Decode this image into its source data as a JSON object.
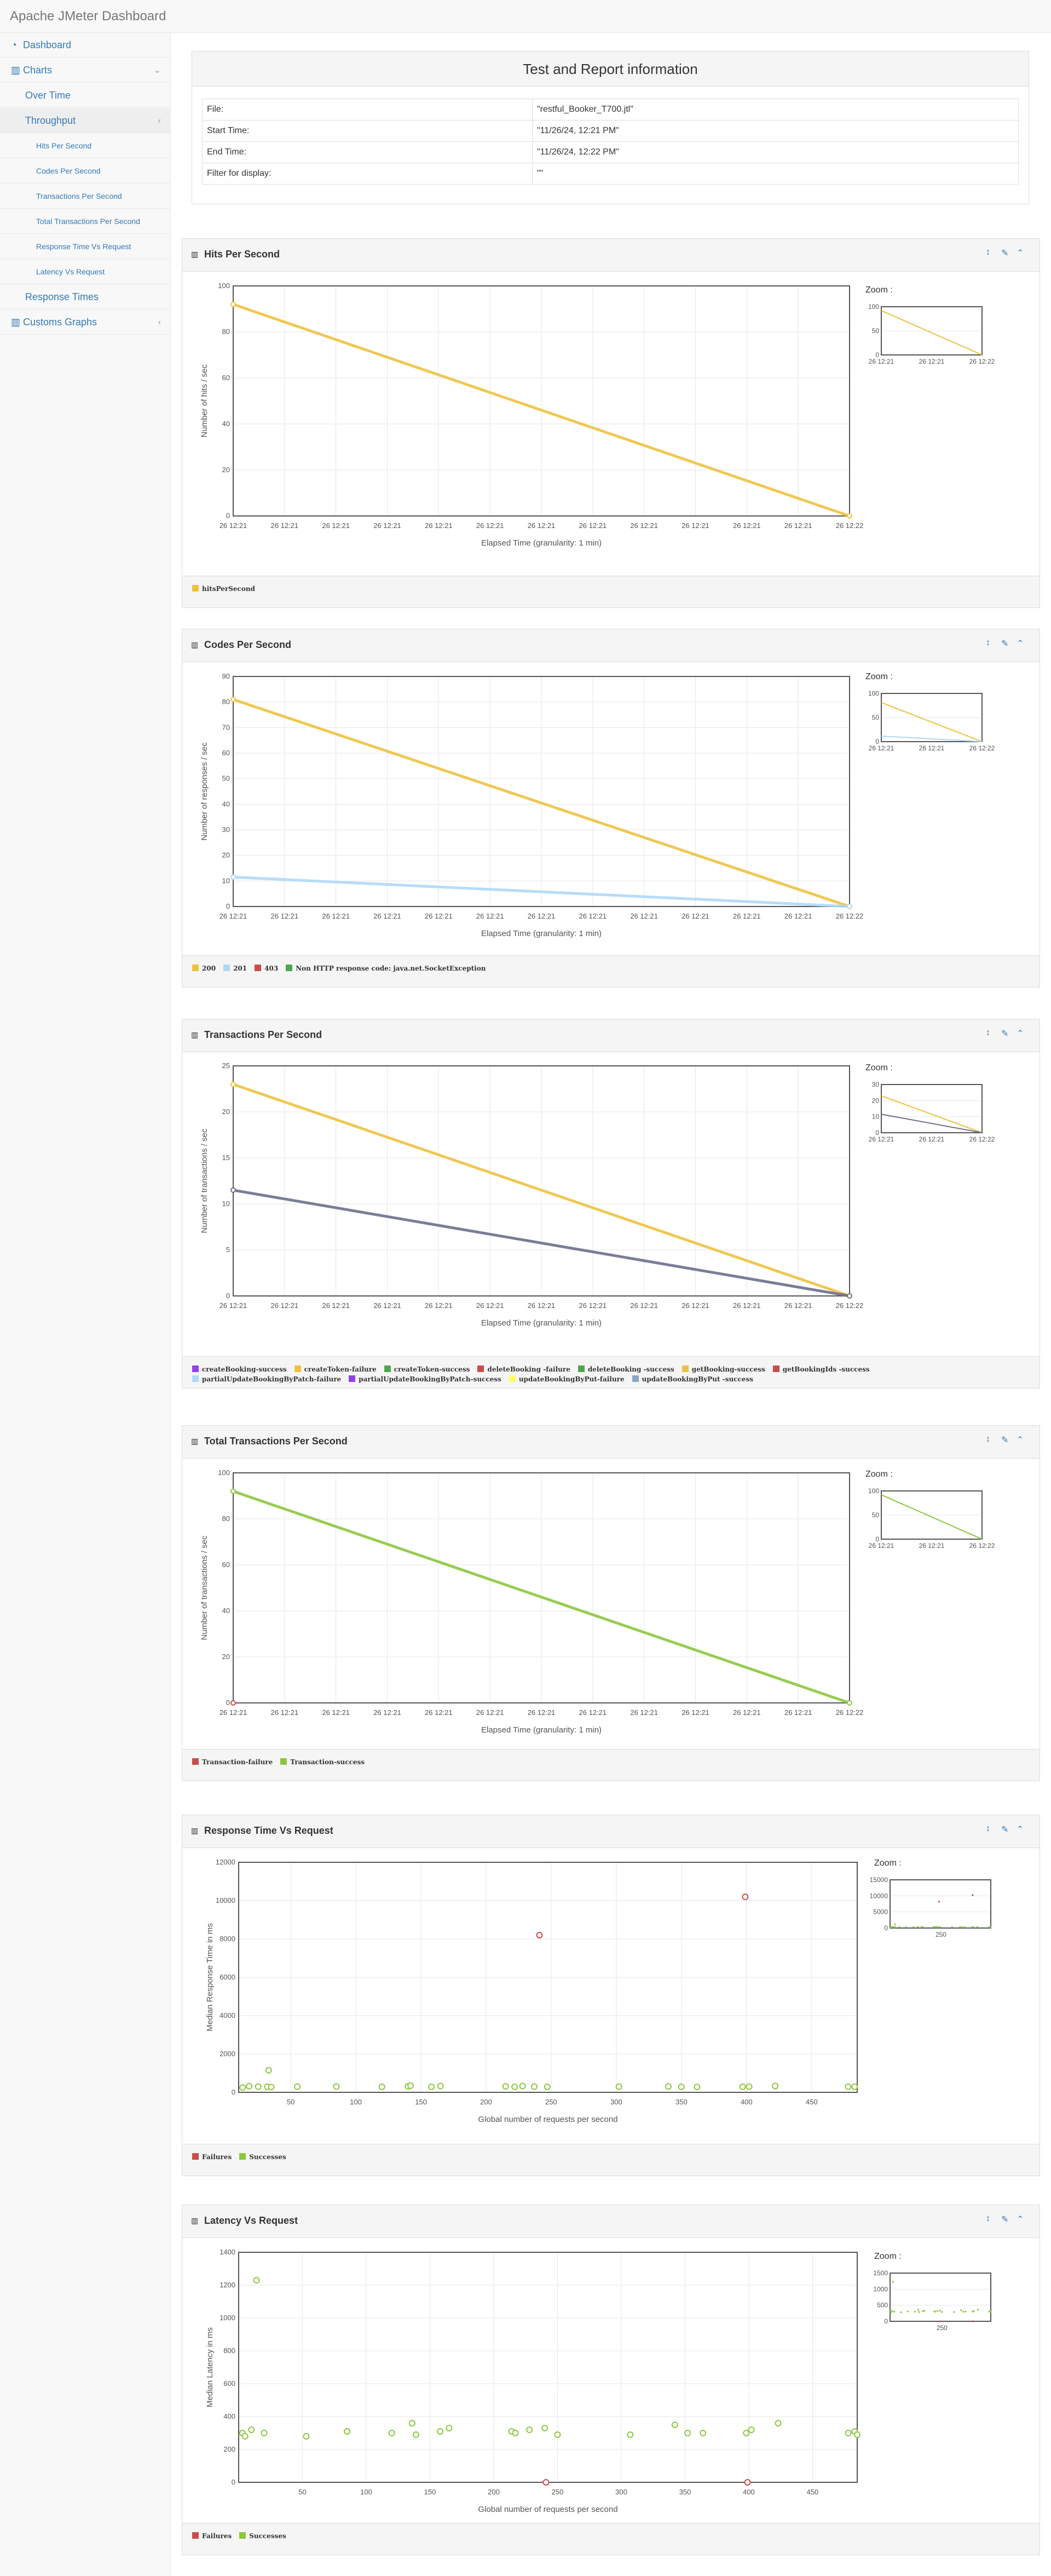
{
  "brand": "Apache JMeter Dashboard",
  "sidebar": {
    "items": [
      {
        "label": "Dashboard",
        "icon": "dashboard-icon"
      },
      {
        "label": "Charts",
        "icon": "bar-chart-icon"
      },
      {
        "label": "Over Time"
      },
      {
        "label": "Throughput"
      },
      {
        "label": "Hits Per Second"
      },
      {
        "label": "Codes Per Second"
      },
      {
        "label": "Transactions Per Second"
      },
      {
        "label": "Total Transactions Per Second"
      },
      {
        "label": "Response Time Vs Request"
      },
      {
        "label": "Latency Vs Request"
      },
      {
        "label": "Response Times"
      },
      {
        "label": "Customs Graphs",
        "icon": "bar-chart-icon"
      }
    ]
  },
  "info": {
    "title": "Test and Report information",
    "rows": [
      {
        "k": "File:",
        "v": "\"restful_Booker_T700.jtl\""
      },
      {
        "k": "Start Time:",
        "v": "\"11/26/24, 12:21 PM\""
      },
      {
        "k": "End Time:",
        "v": "\"11/26/24, 12:22 PM\""
      },
      {
        "k": "Filter for display:",
        "v": "\"\""
      }
    ]
  },
  "zoom_label": "Zoom :",
  "colors": {
    "orange": "#edc240",
    "lightblue": "#afd8f8",
    "red": "#cb4b4b",
    "green": "#4da74d",
    "purple": "#9440ed",
    "slate": "#4a5a8a",
    "lime": "#8cc63f",
    "accent": "#337ab7"
  },
  "chart_data": [
    {
      "id": "hits",
      "title": "Hits Per Second",
      "type": "line",
      "xlabel": "Elapsed Time (granularity: 1 min)",
      "ylabel": "Number of hits / sec",
      "ylim": [
        0,
        100
      ],
      "yticks": [
        0,
        20,
        40,
        60,
        80,
        100
      ],
      "xticklabel": "26 12:21",
      "xticklast": "26 12:22",
      "zoom_yticks": [
        0,
        50,
        100
      ],
      "zoom_xticks": [
        "26 12:21",
        "26 12:21",
        "26 12:22"
      ],
      "series": [
        {
          "name": "hitsPerSecond",
          "color": "#edc240",
          "values": [
            92,
            0
          ]
        }
      ]
    },
    {
      "id": "codes",
      "title": "Codes Per Second",
      "type": "line",
      "xlabel": "Elapsed Time (granularity: 1 min)",
      "ylabel": "Number of responses / sec",
      "ylim": [
        0,
        90
      ],
      "yticks": [
        0,
        10,
        20,
        30,
        40,
        50,
        60,
        70,
        80,
        90
      ],
      "xticklabel": "26 12:21",
      "xticklast": "26 12:22",
      "zoom_yticks": [
        0,
        50,
        100
      ],
      "zoom_xticks": [
        "26 12:21",
        "26 12:21",
        "26 12:22"
      ],
      "series": [
        {
          "name": "200",
          "color": "#edc240",
          "values": [
            81,
            0
          ]
        },
        {
          "name": "201",
          "color": "#afd8f8",
          "values": [
            11.5,
            0
          ]
        },
        {
          "name": "403",
          "color": "#cb4b4b",
          "values": []
        },
        {
          "name": "Non HTTP response code: java.net.SocketException",
          "color": "#4da74d",
          "values": []
        }
      ]
    },
    {
      "id": "transactions",
      "title": "Transactions Per Second",
      "type": "line",
      "xlabel": "Elapsed Time (granularity: 1 min)",
      "ylabel": "Number of transactions / sec",
      "ylim": [
        0,
        25
      ],
      "yticks": [
        0,
        5,
        10,
        15,
        20,
        25
      ],
      "xticklabel": "26 12:21",
      "xticklast": "26 12:22",
      "zoom_yticks": [
        0,
        10,
        20,
        30
      ],
      "zoom_xticks": [
        "26 12:21",
        "26 12:21",
        "26 12:22"
      ],
      "series": [
        {
          "name": "createBooking-success",
          "color": "#9440ed",
          "values": []
        },
        {
          "name": "createToken-failure",
          "color": "#edc240",
          "values": []
        },
        {
          "name": "createToken-success",
          "color": "#4da74d",
          "values": []
        },
        {
          "name": "deleteBooking -failure",
          "color": "#cb4b4b",
          "values": []
        },
        {
          "name": "deleteBooking -success",
          "color": "#4da74d",
          "values": []
        },
        {
          "name": "getBooking-success",
          "color": "#edc240",
          "values": [
            23,
            0
          ]
        },
        {
          "name": "getBookingIds -success",
          "color": "#cb4b4b",
          "values": []
        },
        {
          "name": "partialUpdateBookingByPatch-failure",
          "color": "#afd8f8",
          "values": []
        },
        {
          "name": "partialUpdateBookingByPatch-success",
          "color": "#9440ed",
          "values": []
        },
        {
          "name": "updateBookingByPut-failure",
          "color": "#ffff66",
          "values": []
        },
        {
          "name": "updateBookingByPut -success",
          "color": "#8aa7c8",
          "values": []
        },
        {
          "name": "",
          "color": "#6b6f8c",
          "values": [
            11.5,
            0
          ]
        }
      ]
    },
    {
      "id": "totaltx",
      "title": "Total Transactions Per Second",
      "type": "line",
      "xlabel": "Elapsed Time (granularity: 1 min)",
      "ylabel": "Number of transactions / sec",
      "ylim": [
        0,
        100
      ],
      "yticks": [
        0,
        20,
        40,
        60,
        80,
        100
      ],
      "xticklabel": "26 12:21",
      "xticklast": "26 12:22",
      "zoom_yticks": [
        0,
        50,
        100
      ],
      "zoom_xticks": [
        "26 12:21",
        "26 12:21",
        "26 12:22"
      ],
      "series": [
        {
          "name": "Transaction-failure",
          "color": "#cb4b4b",
          "values": [
            0
          ]
        },
        {
          "name": "Transaction-success",
          "color": "#8cc63f",
          "values": [
            92,
            0
          ]
        }
      ]
    },
    {
      "id": "rtvr",
      "title": "Response Time Vs Request",
      "type": "scatter",
      "xlabel": "Global number of requests per second",
      "ylabel": "Median Response Time in ms",
      "xlim": [
        10,
        485
      ],
      "ylim": [
        0,
        12000
      ],
      "yticks": [
        0,
        2000,
        4000,
        6000,
        8000,
        10000,
        12000
      ],
      "xticks": [
        50,
        100,
        150,
        200,
        250,
        300,
        350,
        400,
        450
      ],
      "zoom_yticks": [
        0,
        5000,
        10000,
        15000
      ],
      "zoom_xticks": [
        "250"
      ],
      "series": [
        {
          "name": "Failures",
          "color": "#cb4b4b",
          "points": [
            [
              241,
              8200
            ],
            [
              399,
              10200
            ]
          ]
        },
        {
          "name": "Successes",
          "color": "#8cc63f",
          "points": [
            [
              13,
              250
            ],
            [
              18,
              320
            ],
            [
              25,
              300
            ],
            [
              32,
              290
            ],
            [
              33,
              1150
            ],
            [
              35,
              280
            ],
            [
              55,
              300
            ],
            [
              85,
              300
            ],
            [
              120,
              290
            ],
            [
              140,
              310
            ],
            [
              142,
              350
            ],
            [
              158,
              290
            ],
            [
              165,
              330
            ],
            [
              215,
              310
            ],
            [
              222,
              290
            ],
            [
              228,
              330
            ],
            [
              237,
              300
            ],
            [
              247,
              290
            ],
            [
              302,
              300
            ],
            [
              340,
              310
            ],
            [
              350,
              290
            ],
            [
              362,
              280
            ],
            [
              397,
              290
            ],
            [
              402,
              300
            ],
            [
              422,
              330
            ],
            [
              478,
              300
            ],
            [
              483,
              290
            ]
          ]
        }
      ]
    },
    {
      "id": "lvr",
      "title": "Latency Vs Request",
      "type": "scatter",
      "xlabel": "Global number of requests per second",
      "ylabel": "Median Latency in ms",
      "xlim": [
        0,
        485
      ],
      "ylim": [
        0,
        1400
      ],
      "yticks": [
        0,
        200,
        400,
        600,
        800,
        1000,
        1200,
        1400
      ],
      "xticks": [
        50,
        100,
        150,
        200,
        250,
        300,
        350,
        400,
        450
      ],
      "zoom_yticks": [
        0,
        500,
        1000,
        1500
      ],
      "zoom_xticks": [
        "250"
      ],
      "series": [
        {
          "name": "Failures",
          "color": "#cb4b4b",
          "points": [
            [
              241,
              0
            ],
            [
              399,
              0
            ]
          ]
        },
        {
          "name": "Successes",
          "color": "#8cc63f",
          "points": [
            [
              3,
              300
            ],
            [
              5,
              280
            ],
            [
              10,
              320
            ],
            [
              14,
              1230
            ],
            [
              20,
              300
            ],
            [
              53,
              280
            ],
            [
              85,
              310
            ],
            [
              120,
              300
            ],
            [
              136,
              360
            ],
            [
              139,
              290
            ],
            [
              158,
              310
            ],
            [
              165,
              330
            ],
            [
              214,
              310
            ],
            [
              217,
              300
            ],
            [
              228,
              320
            ],
            [
              240,
              330
            ],
            [
              250,
              290
            ],
            [
              307,
              290
            ],
            [
              342,
              350
            ],
            [
              352,
              300
            ],
            [
              364,
              300
            ],
            [
              398,
              300
            ],
            [
              402,
              320
            ],
            [
              423,
              360
            ],
            [
              478,
              300
            ],
            [
              483,
              310
            ],
            [
              485,
              290
            ]
          ]
        }
      ]
    }
  ]
}
